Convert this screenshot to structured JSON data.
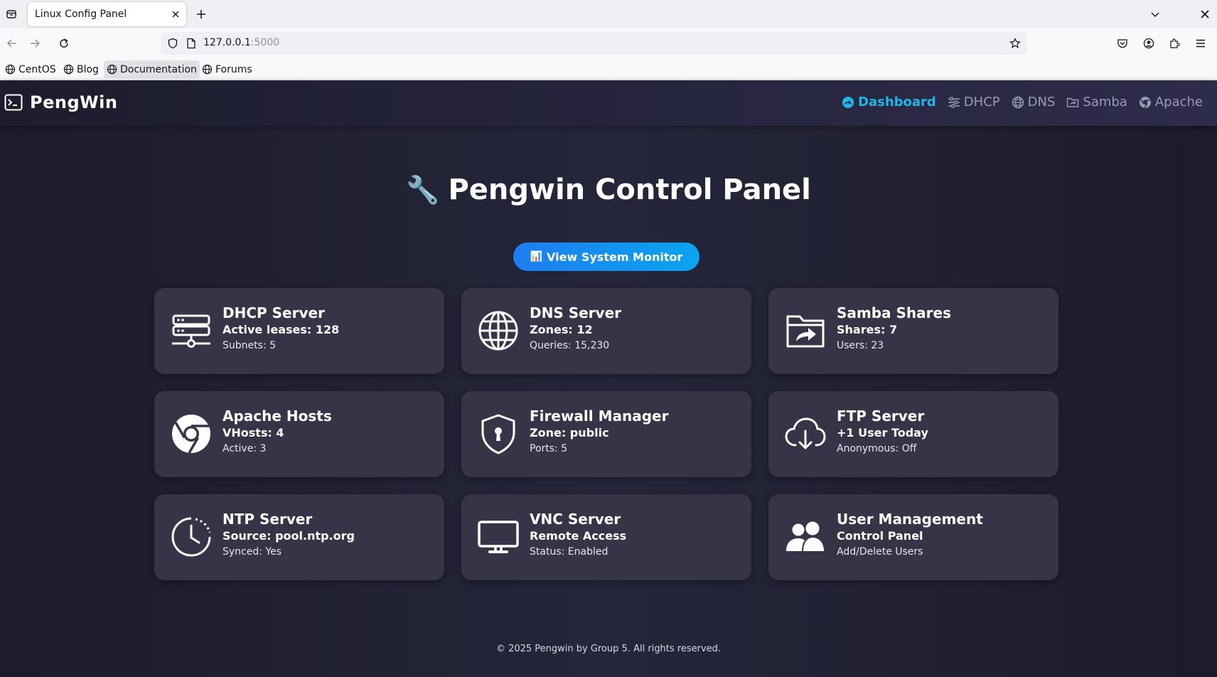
{
  "browser": {
    "tab_title": "Linux Config Panel",
    "url_host": "127.0.0.1",
    "url_port": ":5000",
    "bookmarks": [
      {
        "label": "CentOS"
      },
      {
        "label": "Blog"
      },
      {
        "label": "Documentation"
      },
      {
        "label": "Forums"
      }
    ]
  },
  "app": {
    "brand": "PengWin",
    "nav": [
      {
        "label": "Dashboard",
        "icon": "gauge-icon",
        "active": true
      },
      {
        "label": "DHCP",
        "icon": "sliders-icon"
      },
      {
        "label": "DNS",
        "icon": "globe-icon"
      },
      {
        "label": "Samba",
        "icon": "folder-share-icon"
      },
      {
        "label": "Apache",
        "icon": "chrome-icon"
      }
    ],
    "page_title_icon": "🔧",
    "page_title": "Pengwin Control Panel",
    "monitor_button_icon": "📊",
    "monitor_button": "View System Monitor",
    "cards": [
      {
        "title": "DHCP Server",
        "line1": "Active leases: 128",
        "line2": "Subnets: 5",
        "icon": "network-server-icon"
      },
      {
        "title": "DNS Server",
        "line1": "Zones: 12",
        "line2": "Queries: 15,230",
        "icon": "globe-icon"
      },
      {
        "title": "Samba Shares",
        "line1": "Shares: 7",
        "line2": "Users: 23",
        "icon": "folder-share-icon"
      },
      {
        "title": "Apache Hosts",
        "line1": "VHosts: 4",
        "line2": "Active: 3",
        "icon": "chrome-icon"
      },
      {
        "title": "Firewall Manager",
        "line1": "Zone: public",
        "line2": "Ports: 5",
        "icon": "shield-lock-icon"
      },
      {
        "title": "FTP Server",
        "line1": "+1 User Today",
        "line2": "Anonymous: Off",
        "icon": "cloud-download-icon"
      },
      {
        "title": "NTP Server",
        "line1": "Source: pool.ntp.org",
        "line2": "Synced: Yes",
        "icon": "clock-icon"
      },
      {
        "title": "VNC Server",
        "line1": "Remote Access",
        "line2": "Status: Enabled",
        "icon": "monitor-icon"
      },
      {
        "title": "User Management",
        "line1": "Control Panel",
        "line2": "Add/Delete Users",
        "icon": "users-icon"
      }
    ],
    "footer": "© 2025 Pengwin by Group 5. All rights reserved.",
    "colors": {
      "accent": "#1fb6e8",
      "card_bg": "#363548",
      "button_start": "#1e7df0",
      "button_end": "#0aa5f0"
    }
  }
}
